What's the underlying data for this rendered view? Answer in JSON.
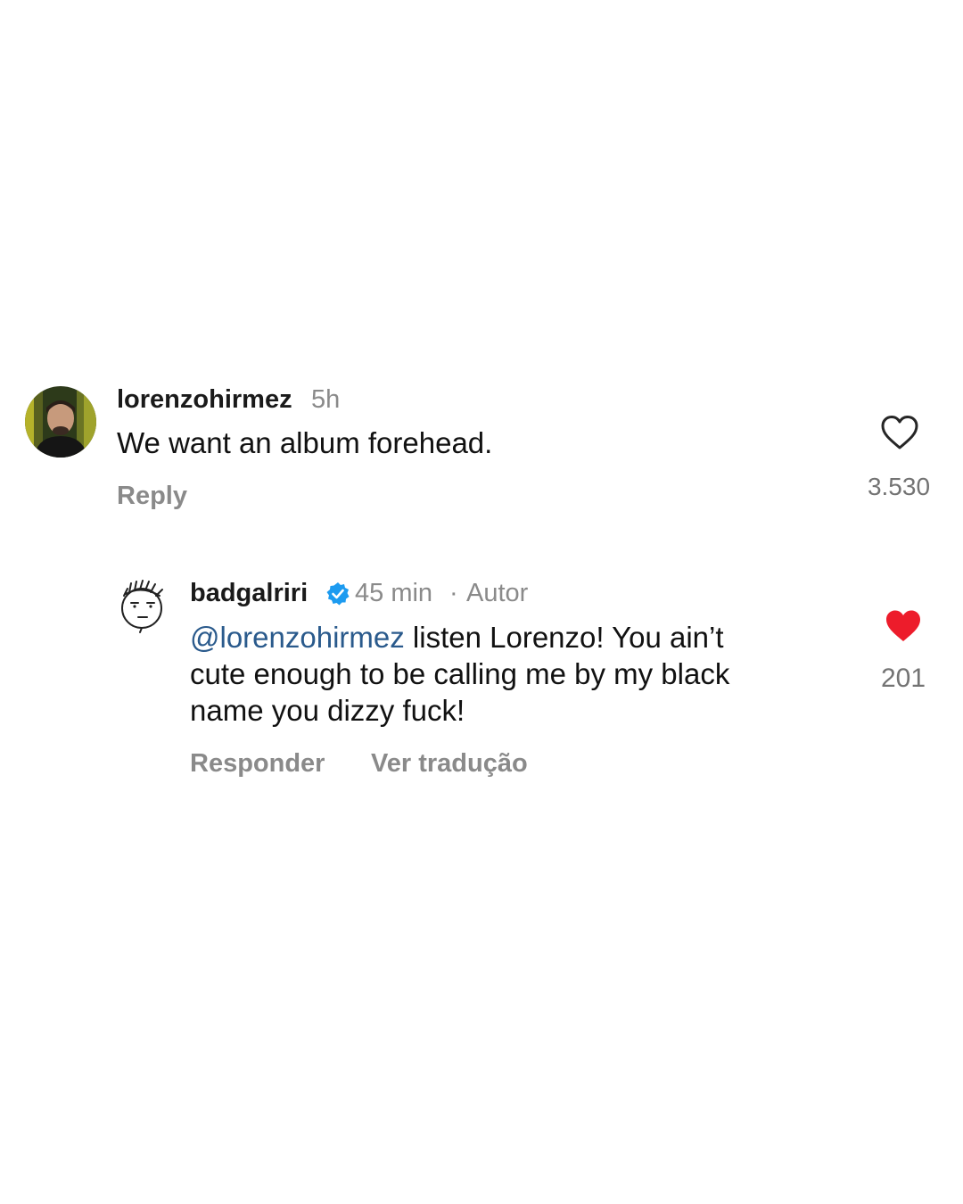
{
  "comments": [
    {
      "username": "lorenzohirmez",
      "time": "5h",
      "text": "We want an album forehead.",
      "reply_label": "Reply",
      "like_count": "3.530",
      "liked": false,
      "avatar_icon": "user-photo-avatar"
    },
    {
      "username": "badgalriri",
      "verified": true,
      "time": "45 min",
      "separator": "·",
      "author_badge": "Autor",
      "mention": "@lorenzohirmez",
      "text_line1_rest": " listen Lorenzo! You ain’t",
      "text_line2": "cute enough to be calling me by my black",
      "text_line3": "name you dizzy fuck!",
      "reply_label": "Responder",
      "translate_label": "Ver tradução",
      "like_count": "201",
      "liked": true,
      "avatar_icon": "doodle-face-avatar"
    }
  ],
  "colors": {
    "liked_heart": "#ed1c2b",
    "mention": "#2a5a8c",
    "verified_badge": "#1d9bf0",
    "secondary_text": "#8a8a8a"
  }
}
